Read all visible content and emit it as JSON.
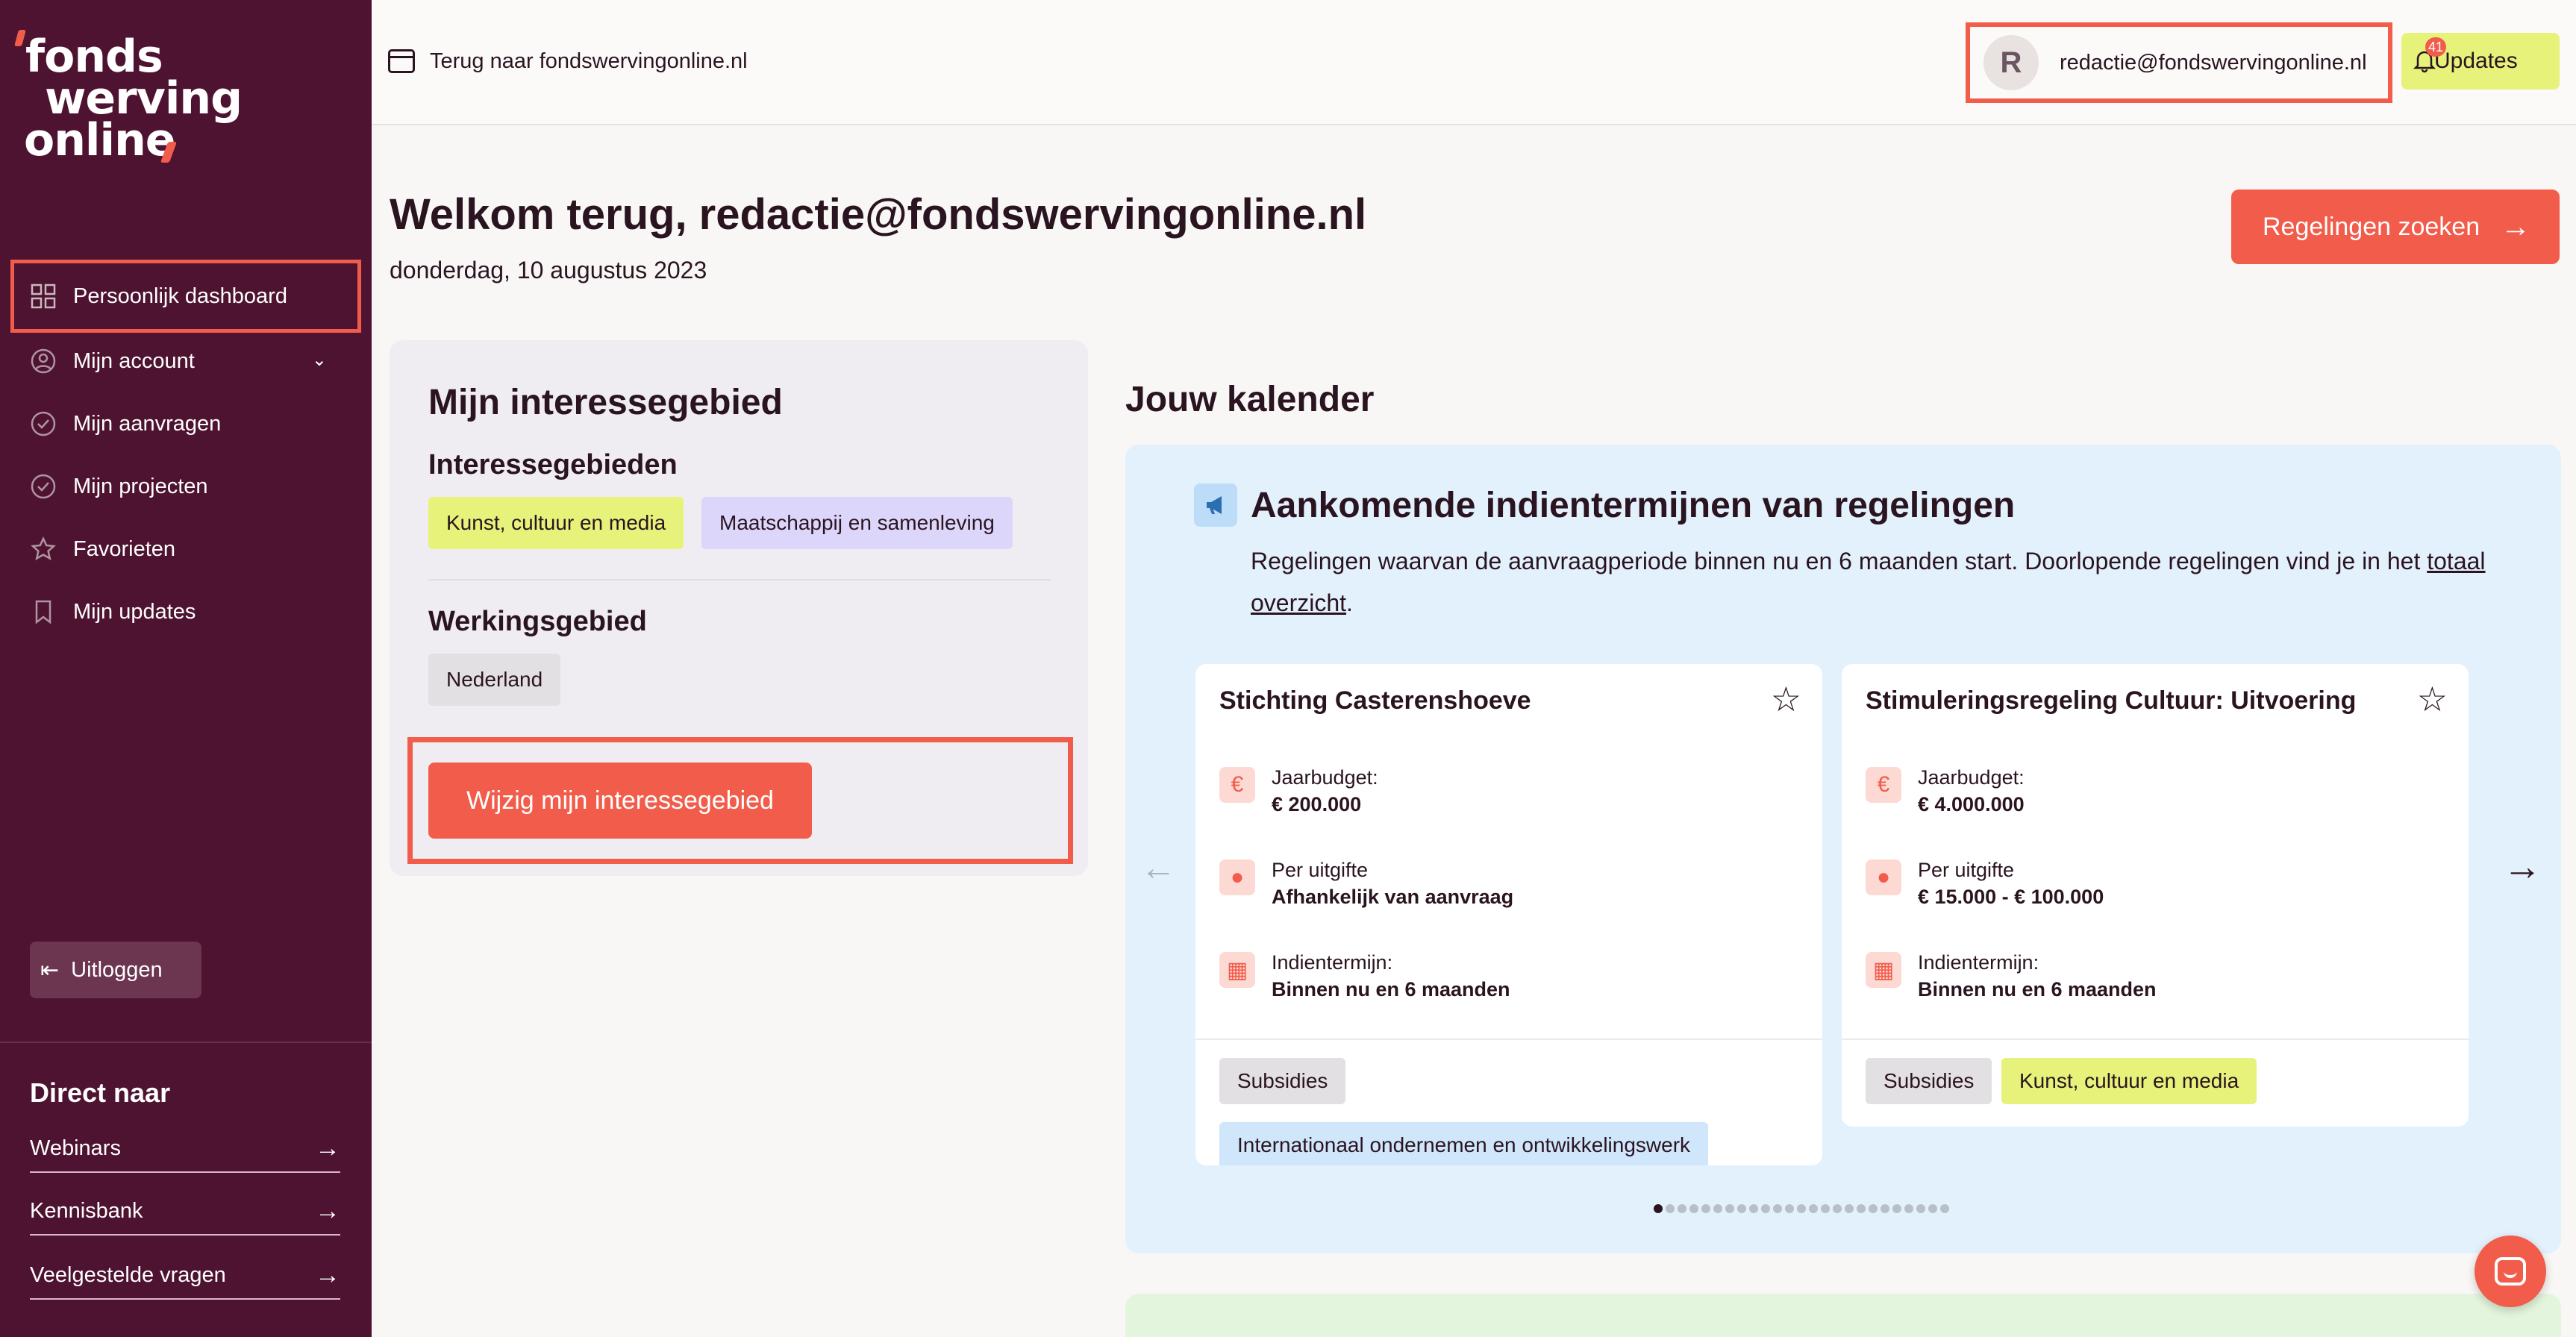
{
  "logo": {
    "line1": "fonds",
    "line2": "werving",
    "line3": "online"
  },
  "sidebar": {
    "items": [
      {
        "label": "Persoonlijk dashboard",
        "icon": "grid-icon"
      },
      {
        "label": "Mijn account",
        "icon": "user-circle-icon"
      },
      {
        "label": "Mijn aanvragen",
        "icon": "check-circle-icon"
      },
      {
        "label": "Mijn projecten",
        "icon": "check-circle-icon"
      },
      {
        "label": "Favorieten",
        "icon": "star-icon"
      },
      {
        "label": "Mijn updates",
        "icon": "bookmark-icon"
      }
    ],
    "logout": "Uitloggen",
    "direct_title": "Direct naar",
    "direct_links": [
      "Webinars",
      "Kennisbank",
      "Veelgestelde vragen"
    ]
  },
  "topbar": {
    "back": "Terug naar fondswervingonline.nl",
    "avatar": "R",
    "email": "redactie@fondswervingonline.nl",
    "updates": "Updates",
    "updates_count": "41"
  },
  "main": {
    "welcome": "Welkom terug, redactie@fondswervingonline.nl",
    "date": "donderdag, 10 augustus 2023",
    "search_button": "Regelingen zoeken"
  },
  "interest": {
    "title": "Mijn interessegebied",
    "sub": "Interessegebieden",
    "tags": [
      "Kunst, cultuur en media",
      "Maatschappij en samenleving"
    ],
    "werk_title": "Werkingsgebied",
    "werk_tag": "Nederland",
    "button": "Wijzig mijn interessegebied"
  },
  "kalender": {
    "title": "Jouw kalender",
    "heading": "Aankomende indientermijnen van regelingen",
    "desc_before": "Regelingen waarvan de aanvraagperiode binnen nu en 6 maanden start. Doorlopende regelingen vind je in het ",
    "desc_link": "totaal overzicht",
    "desc_after": ".",
    "cards": [
      {
        "title": "Stichting Casterenshoeve",
        "budget_label": "Jaarbudget:",
        "budget": "€ 200.000",
        "per_label": "Per uitgifte",
        "per": "Afhankelijk van aanvraag",
        "term_label": "Indientermijn:",
        "term": "Binnen nu en 6 maanden",
        "tags": [
          "Subsidies",
          "Internationaal ondernemen en ontwikkelingswerk"
        ]
      },
      {
        "title": "Stimuleringsregeling Cultuur: Uitvoering",
        "budget_label": "Jaarbudget:",
        "budget": "€ 4.000.000",
        "per_label": "Per uitgifte",
        "per": "€ 15.000 - € 100.000",
        "term_label": "Indientermijn:",
        "term": "Binnen nu en 6 maanden",
        "tags": [
          "Subsidies",
          "Kunst, cultuur en media"
        ]
      }
    ],
    "page_count": 25,
    "current_page": 1
  },
  "colors": {
    "sidebar": "#4e1330",
    "accent": "#f25c4a",
    "lime": "#e6f27a",
    "lilac": "#ddd6fb",
    "calendar_bg": "#e3f1fd"
  }
}
